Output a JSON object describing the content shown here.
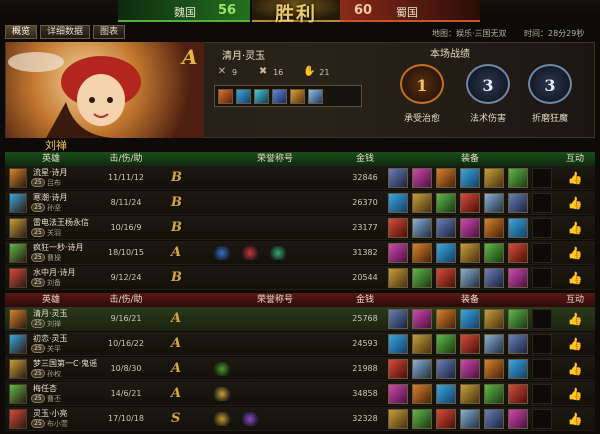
{
  "top": {
    "left_faction": "魏国",
    "left_score": "56",
    "emblem": "胜利",
    "right_score": "60",
    "right_faction": "蜀国"
  },
  "tabs": [
    "概览",
    "详细数据",
    "图表"
  ],
  "info": {
    "map": "地图：娱乐·三国无双",
    "time": "时间：28分29秒"
  },
  "featured": {
    "rank": "A",
    "name": "清月·灵玉",
    "kills": "9",
    "deaths": "16",
    "assists": "21",
    "stats_title": "本场战绩",
    "badges": [
      {
        "value": "1",
        "label": "承受治愈",
        "color": "#c4701f"
      },
      {
        "value": "3",
        "label": "法术伤害",
        "color": "#6f87a8"
      },
      {
        "value": "3",
        "label": "折磨狂魔",
        "color": "#6f87a8"
      }
    ]
  },
  "team_green": {
    "name": "刘禅",
    "headers": [
      "英雄",
      "击/伤/助",
      "荣誉称号",
      "金钱",
      "装备",
      "互动"
    ],
    "rows": [
      {
        "hero": "流星·诗月",
        "level": "25",
        "player": "吕布",
        "kda": "11/11/12",
        "rank": "B",
        "gold": "32846",
        "titles": []
      },
      {
        "hero": "寒潮·诗月",
        "level": "25",
        "player": "孙坚",
        "kda": "8/11/24",
        "rank": "B",
        "gold": "26370",
        "titles": []
      },
      {
        "hero": "雷电法王杨永信",
        "level": "25",
        "player": "关羽",
        "kda": "10/16/9",
        "rank": "B",
        "gold": "23177",
        "titles": []
      },
      {
        "hero": "疯狂一秒·诗月",
        "level": "25",
        "player": "曹操",
        "kda": "18/10/15",
        "rank": "A",
        "gold": "31382",
        "titles": [
          "#3a6fc9",
          "#c63a3a",
          "#3aa86a"
        ]
      },
      {
        "hero": "水中月·诗月",
        "level": "25",
        "player": "刘备",
        "kda": "9/12/24",
        "rank": "B",
        "gold": "20544",
        "titles": []
      }
    ]
  },
  "team_red": {
    "headers": [
      "英雄",
      "击/伤/助",
      "荣誉称号",
      "金钱",
      "装备",
      "互动"
    ],
    "rows": [
      {
        "hero": "清月·灵玉",
        "level": "25",
        "player": "刘禅",
        "kda": "9/16/21",
        "rank": "A",
        "gold": "25768",
        "titles": [],
        "hl": true
      },
      {
        "hero": "初恋·灵玉",
        "level": "25",
        "player": "关平",
        "kda": "10/16/22",
        "rank": "A",
        "gold": "24593",
        "titles": []
      },
      {
        "hero": "梦三国第一C·鬼谣",
        "level": "25",
        "player": "孙权",
        "kda": "10/8/30",
        "rank": "A",
        "gold": "21988",
        "titles": [
          "#4a9a2a"
        ]
      },
      {
        "hero": "梅任杏",
        "level": "25",
        "player": "曹丕",
        "kda": "14/6/21",
        "rank": "A",
        "gold": "34858",
        "titles": [
          "#c8a03a"
        ]
      },
      {
        "hero": "灵玉·小亮",
        "level": "25",
        "player": "布小萱",
        "kda": "17/10/18",
        "rank": "S",
        "gold": "32328",
        "titles": [
          "#c89a2a",
          "#8a4ac9"
        ]
      }
    ]
  }
}
